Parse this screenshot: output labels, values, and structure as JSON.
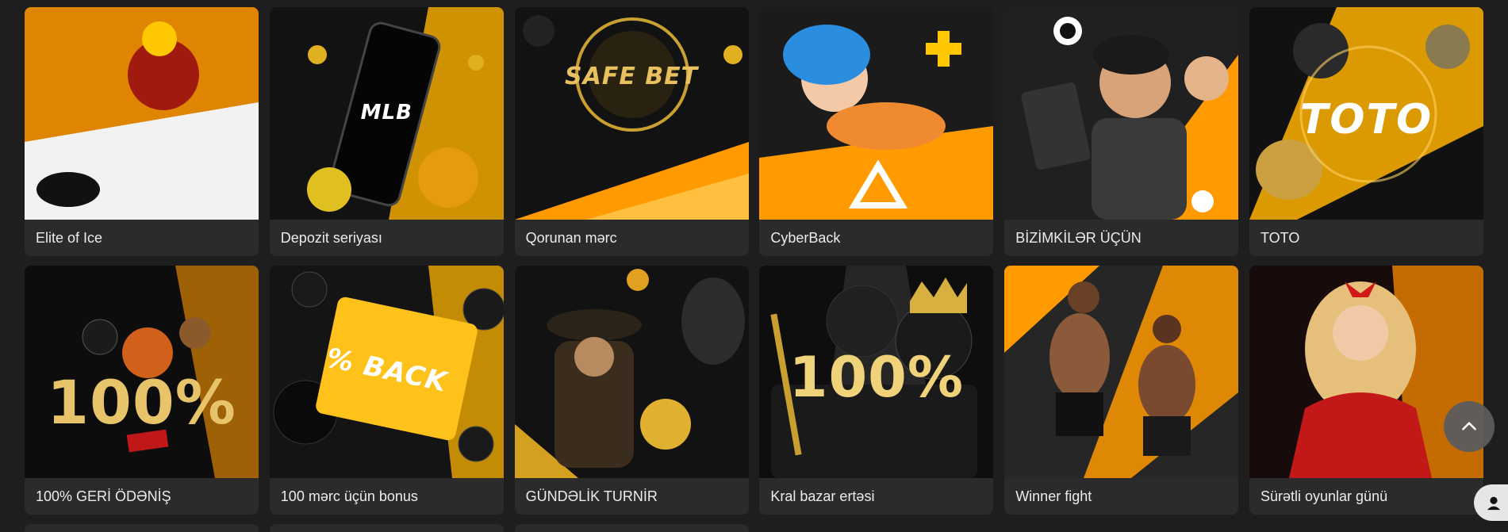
{
  "promotions": [
    {
      "title": "Elite of Ice",
      "image_text": "",
      "colors": [
        "#ff9a00",
        "#7a1a10"
      ]
    },
    {
      "title": "Depozit seriyası",
      "image_text": "MLB",
      "colors": [
        "#ffb300",
        "#111111"
      ]
    },
    {
      "title": "Qorunan mərc",
      "image_text": "SAFE BET",
      "colors": [
        "#ff9a00",
        "#1a1a1a"
      ]
    },
    {
      "title": "CyberBack",
      "image_text": "",
      "colors": [
        "#ff9a00",
        "#1c1c1c"
      ]
    },
    {
      "title": "BİZİMKİLƏR ÜÇÜN",
      "image_text": "",
      "colors": [
        "#ff9a00",
        "#222222"
      ]
    },
    {
      "title": "TOTO",
      "image_text": "TOTO",
      "colors": [
        "#ffb300",
        "#151515"
      ]
    },
    {
      "title": "100% GERİ ÖDƏNİŞ",
      "image_text": "100%",
      "colors": [
        "#ff9a00",
        "#0f0f0f"
      ]
    },
    {
      "title": "100 mərc üçün bonus",
      "image_text": "% BACK",
      "colors": [
        "#ffb300",
        "#161616"
      ]
    },
    {
      "title": "GÜNDƏLİK TURNİR",
      "image_text": "",
      "colors": [
        "#d4a020",
        "#151515"
      ]
    },
    {
      "title": "Kral bazar ertəsi",
      "image_text": "100%",
      "colors": [
        "#cfcfcf",
        "#101010"
      ]
    },
    {
      "title": "Winner fight",
      "image_text": "",
      "colors": [
        "#ff9a00",
        "#262626"
      ]
    },
    {
      "title": "Sürətli oyunlar günü",
      "image_text": "",
      "colors": [
        "#ff8c00",
        "#1a0d0d"
      ]
    }
  ]
}
